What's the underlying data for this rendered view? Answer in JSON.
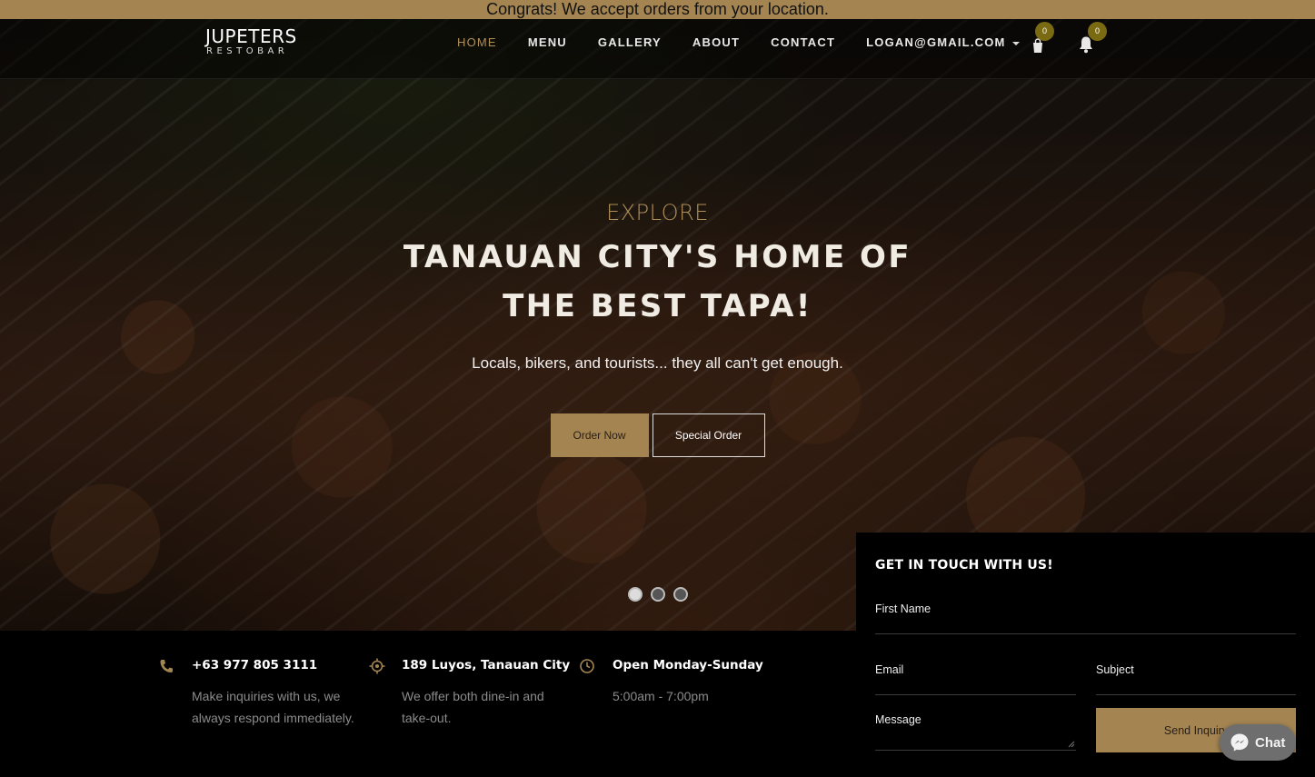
{
  "announcement": "Congrats! We accept orders from your location.",
  "brand": {
    "name": "JUPETERS",
    "sub": "RESTOBAR"
  },
  "nav": {
    "items": [
      "HOME",
      "MENU",
      "GALLERY",
      "ABOUT",
      "CONTACT"
    ],
    "account": "LOGAN@GMAIL.COM",
    "cart_count": "0",
    "notif_count": "0"
  },
  "hero": {
    "eyebrow": "EXPLORE",
    "headline": "TANAUAN CITY'S HOME OF THE BEST TAPA!",
    "tagline": "Locals, bikers, and tourists... they all can't get enough.",
    "order_btn": "Order Now",
    "special_btn": "Special Order",
    "slides": 3,
    "active_slide": 1
  },
  "info": [
    {
      "icon": "phone-icon",
      "title": "+63 977 805 3111",
      "desc": "Make inquiries with us, we always respond immediately."
    },
    {
      "icon": "location-icon",
      "title": "189 Luyos, Tanauan City",
      "desc": "We offer both dine-in and take-out."
    },
    {
      "icon": "clock-icon",
      "title": "Open Monday-Sunday",
      "desc": "5:00am - 7:00pm"
    }
  ],
  "contact": {
    "heading": "GET IN TOUCH WITH US!",
    "first_name": "First Name",
    "email": "Email",
    "subject": "Subject",
    "message": "Message",
    "send": "Send Inquiry"
  },
  "chat": {
    "label": "Chat"
  },
  "colors": {
    "accent": "#a48552",
    "badge": "#7a6a12"
  }
}
